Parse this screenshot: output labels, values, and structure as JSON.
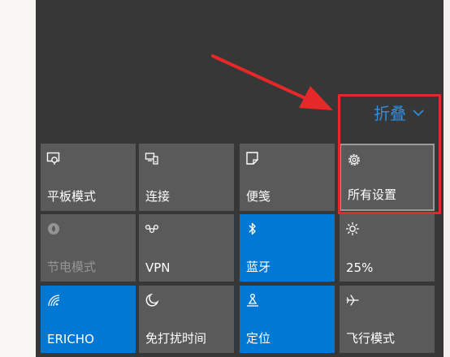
{
  "header": {
    "collapse_label": "折叠"
  },
  "tiles": [
    {
      "label": "平板模式",
      "icon": "tablet-mode-icon",
      "state": "off"
    },
    {
      "label": "连接",
      "icon": "connect-icon",
      "state": "off"
    },
    {
      "label": "便笺",
      "icon": "note-icon",
      "state": "off"
    },
    {
      "label": "所有设置",
      "icon": "gear-icon",
      "state": "selected"
    },
    {
      "label": "节电模式",
      "icon": "battery-saver-icon",
      "state": "disabled"
    },
    {
      "label": "VPN",
      "icon": "vpn-icon",
      "state": "off"
    },
    {
      "label": "蓝牙",
      "icon": "bluetooth-icon",
      "state": "on"
    },
    {
      "label": "25%",
      "icon": "brightness-icon",
      "state": "off"
    },
    {
      "label": "ERICHO",
      "icon": "wifi-icon",
      "state": "on"
    },
    {
      "label": "免打扰时间",
      "icon": "moon-icon",
      "state": "off"
    },
    {
      "label": "定位",
      "icon": "location-icon",
      "state": "on"
    },
    {
      "label": "飞行模式",
      "icon": "airplane-icon",
      "state": "off"
    }
  ],
  "colors": {
    "panel_bg": "#373737",
    "tile_bg": "#5a5a5a",
    "tile_active": "#0078d4",
    "accent_text": "#2f8fe0",
    "highlight_red": "#e52828"
  }
}
